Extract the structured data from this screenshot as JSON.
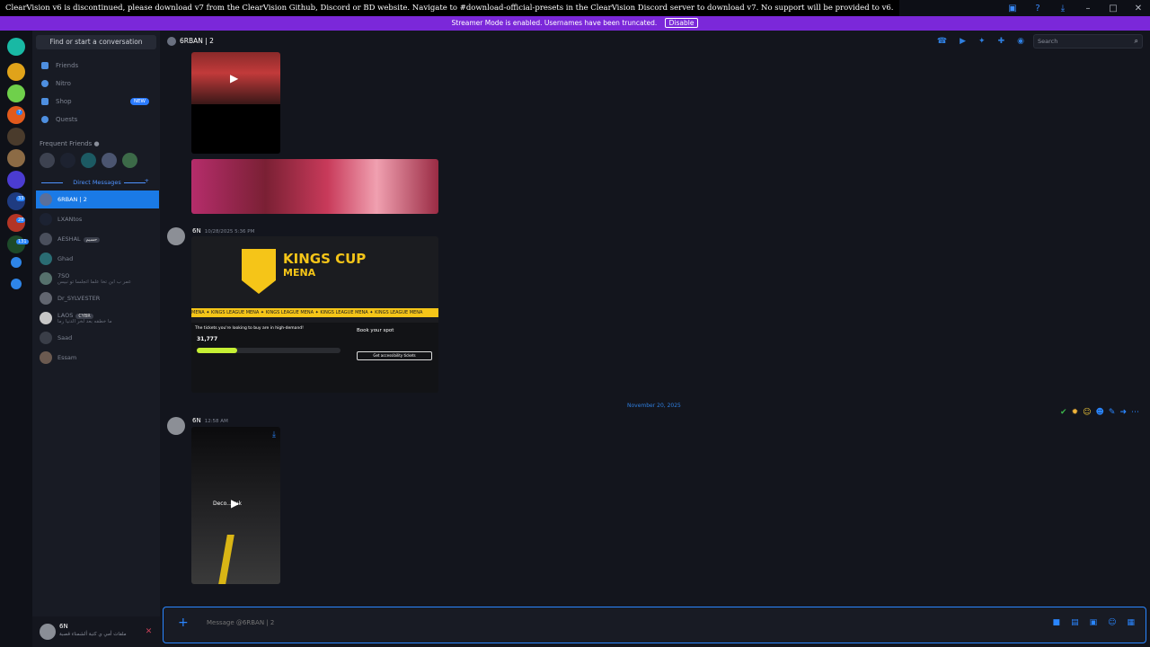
{
  "topbar": {
    "notice": "ClearVision v6 is discontinued, please download v7 from the ClearVision Github, Discord or BD website. Navigate to #download-official-presets in the ClearVision Discord server to download v7. No support will be provided to v6."
  },
  "streamer_bar": {
    "text": "Streamer Mode is enabled. Usernames have been truncated.",
    "button": "Disable"
  },
  "guilds": {
    "badges": [
      "7",
      "33",
      "28",
      "131"
    ]
  },
  "sidebar": {
    "search_placeholder": "Find or start a conversation",
    "nav": [
      {
        "label": "Friends"
      },
      {
        "label": "Nitro"
      },
      {
        "label": "Shop",
        "badge": "NEW"
      },
      {
        "label": "Quests"
      }
    ],
    "frequent_friends_label": "Frequent Friends",
    "direct_messages_label": "Direct Messages",
    "dms": [
      {
        "name": "6RBAN | 2"
      },
      {
        "name": "LXANtos"
      },
      {
        "name": "AESHAL",
        "tag": "حسيم"
      },
      {
        "name": "Ghad"
      },
      {
        "name": "7SO",
        "sub": "عمر ب ابن تخا علما اتجلسا تو نبيس"
      },
      {
        "name": "Dr_SYLVESTER"
      },
      {
        "name": "LAOS",
        "tag": "CYBR",
        "sub": "ما خطفه بعد لخر الدنيا رما"
      },
      {
        "name": "Saad"
      },
      {
        "name": "Essam"
      }
    ]
  },
  "user_panel": {
    "username": "6N",
    "status": "ملفات أمي ي كتبة ألشمناء قصبة"
  },
  "chat": {
    "channel_title": "6RBAN | 2",
    "search_placeholder": "Search",
    "messages": [
      {
        "author": "6N",
        "time": "10/28/2025 5:36 PM"
      },
      {
        "author": "6N",
        "time": "12:58 AM"
      }
    ],
    "kings_card": {
      "title": "KINGS CUP",
      "subtitle": "MENA",
      "ticker": "MENA ✦ KINGS LEAGUE MENA ✦ KINGS LEAGUE MENA ✦ KINGS LEAGUE MENA ✦ KINGS LEAGUE MENA",
      "demand_text": "The tickets you're looking to buy are in high-demand!",
      "queue_number": "31,777",
      "book_text": "Book your spot",
      "access_btn": "Get accessibility tickets"
    },
    "video_caption": "Deco...buk",
    "date_divider": "November 20, 2025",
    "composer_placeholder": "Message @6RBAN | 2"
  }
}
